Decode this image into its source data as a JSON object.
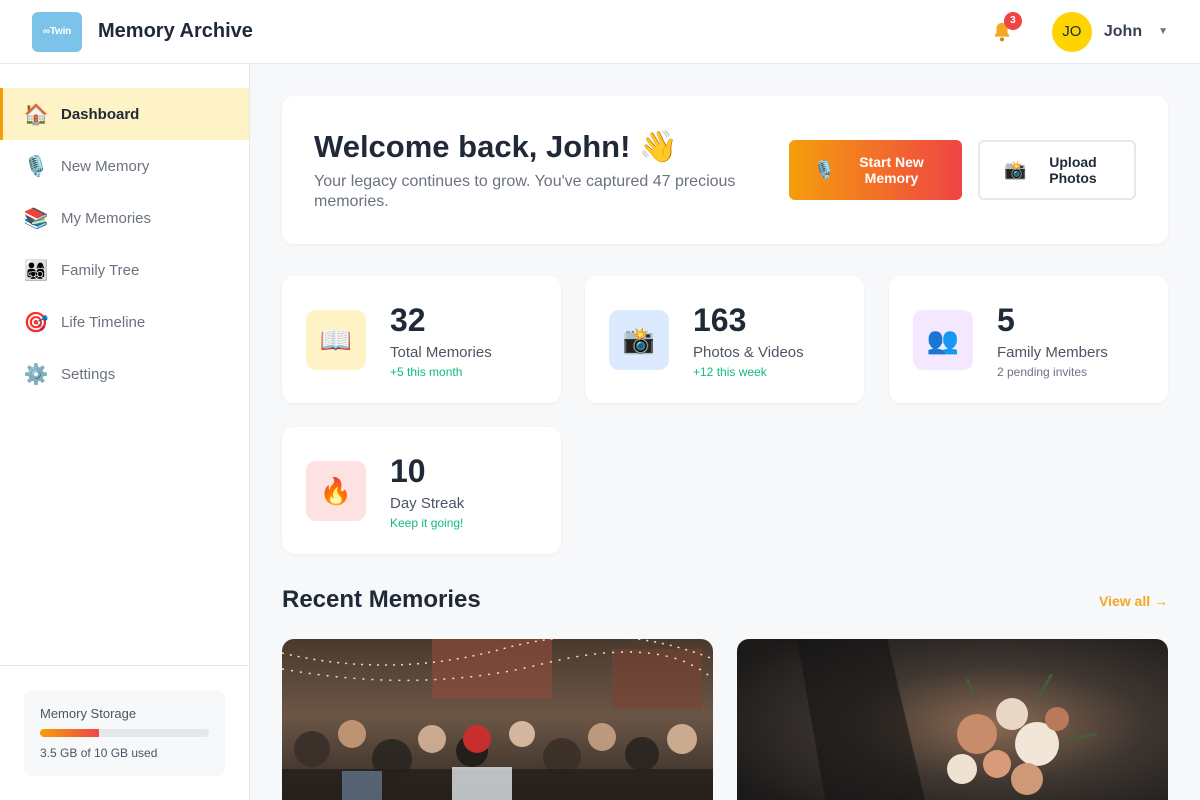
{
  "header": {
    "logo_text": "∞Twin",
    "app_title": "Memory Archive",
    "notification_count": "3",
    "user": {
      "initials": "JO",
      "name": "John"
    }
  },
  "sidebar": {
    "items": [
      {
        "label": "Dashboard",
        "icon": "home-icon",
        "glyph": "🏠",
        "active": true
      },
      {
        "label": "New Memory",
        "icon": "microphone-icon",
        "glyph": "🎙️"
      },
      {
        "label": "My Memories",
        "icon": "books-icon",
        "glyph": "📚"
      },
      {
        "label": "Family Tree",
        "icon": "family-icon",
        "glyph": "👨‍👩‍👧‍👦"
      },
      {
        "label": "Life Timeline",
        "icon": "target-icon",
        "glyph": "🎯"
      },
      {
        "label": "Settings",
        "icon": "gear-icon",
        "glyph": "⚙️"
      }
    ],
    "storage": {
      "label": "Memory Storage",
      "used_fraction": 0.35,
      "text": "3.5 GB of 10 GB used"
    }
  },
  "welcome": {
    "title": "Welcome back, John! 👋",
    "subtitle": "Your legacy continues to grow. You've captured 47 precious memories.",
    "primary_button": {
      "icon": "microphone-icon",
      "glyph": "🎙️",
      "label": "Start New Memory"
    },
    "secondary_button": {
      "icon": "camera-icon",
      "glyph": "📸",
      "label": "Upload Photos"
    }
  },
  "stats": [
    {
      "icon": "book-icon",
      "glyph": "📖",
      "value": "32",
      "label": "Total Memories",
      "sub": "+5 this month",
      "sub_color": "green",
      "bg": "#fdf3c7"
    },
    {
      "icon": "camera-icon",
      "glyph": "📸",
      "value": "163",
      "label": "Photos & Videos",
      "sub": "+12 this week",
      "sub_color": "green",
      "bg": "#dbeafe"
    },
    {
      "icon": "people-icon",
      "glyph": "👥",
      "value": "5",
      "label": "Family Members",
      "sub": "2 pending invites",
      "sub_color": "gray",
      "bg": "#f3e8ff"
    },
    {
      "icon": "fire-icon",
      "glyph": "🔥",
      "value": "10",
      "label": "Day Streak",
      "sub": "Keep it going!",
      "sub_color": "green",
      "bg": "#fee2e2"
    }
  ],
  "recent": {
    "title": "Recent Memories",
    "view_all": "View all →",
    "cards": [
      {
        "image": "party-crowd-photo"
      },
      {
        "image": "wedding-bouquet-photo"
      }
    ]
  },
  "colors": {
    "accent": "#f59e0b",
    "accent_end": "#ef4444",
    "active_bg": "#fef3c7",
    "success": "#10b981"
  }
}
